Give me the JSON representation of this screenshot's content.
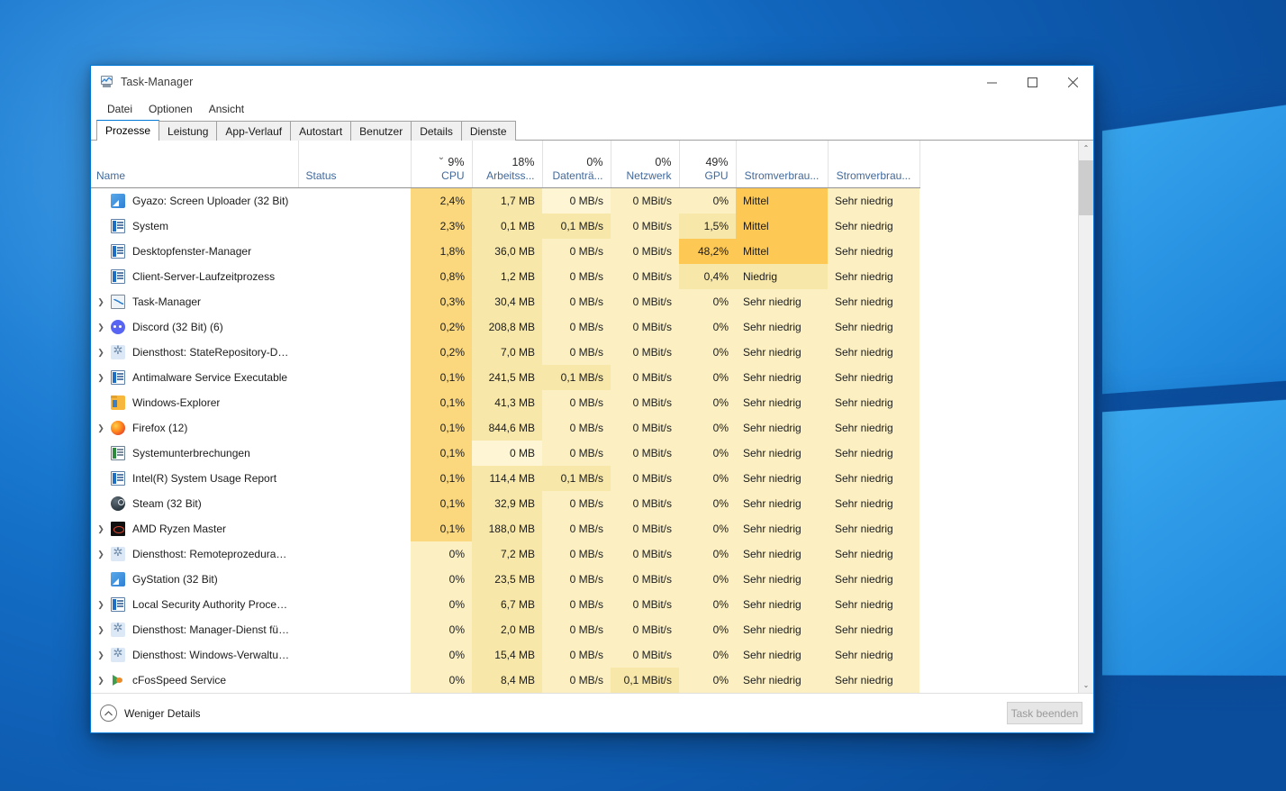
{
  "window": {
    "title": "Task-Manager",
    "title_icon": "task-manager-icon",
    "minimize_label": "−",
    "maximize_label": "□",
    "close_label": "✕"
  },
  "menu": {
    "items": [
      "Datei",
      "Optionen",
      "Ansicht"
    ]
  },
  "tabs": [
    {
      "label": "Prozesse",
      "active": true
    },
    {
      "label": "Leistung",
      "active": false
    },
    {
      "label": "App-Verlauf",
      "active": false
    },
    {
      "label": "Autostart",
      "active": false
    },
    {
      "label": "Benutzer",
      "active": false
    },
    {
      "label": "Details",
      "active": false
    },
    {
      "label": "Dienste",
      "active": false
    }
  ],
  "table": {
    "columns": [
      {
        "key": "name",
        "pct": "",
        "label": "Name",
        "align": "left",
        "sorted": false
      },
      {
        "key": "status",
        "pct": "",
        "label": "Status",
        "align": "left",
        "sorted": false
      },
      {
        "key": "cpu",
        "pct": "9%",
        "label": "CPU",
        "align": "right",
        "sorted": true
      },
      {
        "key": "memory",
        "pct": "18%",
        "label": "Arbeitss...",
        "align": "right",
        "sorted": false
      },
      {
        "key": "disk",
        "pct": "0%",
        "label": "Datenträ...",
        "align": "right",
        "sorted": false
      },
      {
        "key": "network",
        "pct": "0%",
        "label": "Netzwerk",
        "align": "right",
        "sorted": false
      },
      {
        "key": "gpu",
        "pct": "49%",
        "label": "GPU",
        "align": "right",
        "sorted": false
      },
      {
        "key": "power",
        "pct": "",
        "label": "Stromverbrau...",
        "align": "left",
        "sorted": false
      },
      {
        "key": "power2",
        "pct": "",
        "label": "Stromverbrau...",
        "align": "left",
        "sorted": false
      }
    ],
    "sort_indicator": "⌄",
    "rows": [
      {
        "expand": false,
        "icon": "gyazo-icon",
        "name": "Gyazo: Screen Uploader (32 Bit)",
        "status": "",
        "cpu": "2,4%",
        "memory": "1,7 MB",
        "disk": "0 MB/s",
        "network": "0 MBit/s",
        "gpu": "0%",
        "power": "Mittel",
        "power2": "Sehr niedrig",
        "heat": {
          "cpu": "h3",
          "memory": "h2",
          "disk": "h0",
          "network": "h1",
          "gpu": "h1",
          "power": "h4",
          "power2": "h1"
        }
      },
      {
        "expand": false,
        "icon": "windows-service-icon",
        "name": "System",
        "status": "",
        "cpu": "2,3%",
        "memory": "0,1 MB",
        "disk": "0,1 MB/s",
        "network": "0 MBit/s",
        "gpu": "1,5%",
        "power": "Mittel",
        "power2": "Sehr niedrig",
        "heat": {
          "cpu": "h3",
          "memory": "h2",
          "disk": "h2",
          "network": "h1",
          "gpu": "h2",
          "power": "h4",
          "power2": "h1"
        }
      },
      {
        "expand": false,
        "icon": "windows-service-icon",
        "name": "Desktopfenster-Manager",
        "status": "",
        "cpu": "1,8%",
        "memory": "36,0 MB",
        "disk": "0 MB/s",
        "network": "0 MBit/s",
        "gpu": "48,2%",
        "power": "Mittel",
        "power2": "Sehr niedrig",
        "heat": {
          "cpu": "h3",
          "memory": "h2",
          "disk": "h1",
          "network": "h1",
          "gpu": "h4",
          "power": "h4",
          "power2": "h1"
        }
      },
      {
        "expand": false,
        "icon": "windows-service-icon",
        "name": "Client-Server-Laufzeitprozess",
        "status": "",
        "cpu": "0,8%",
        "memory": "1,2 MB",
        "disk": "0 MB/s",
        "network": "0 MBit/s",
        "gpu": "0,4%",
        "power": "Niedrig",
        "power2": "Sehr niedrig",
        "heat": {
          "cpu": "h3",
          "memory": "h2",
          "disk": "h1",
          "network": "h1",
          "gpu": "h2",
          "power": "h2",
          "power2": "h1"
        }
      },
      {
        "expand": true,
        "icon": "task-manager-icon",
        "name": "Task-Manager",
        "status": "",
        "cpu": "0,3%",
        "memory": "30,4 MB",
        "disk": "0 MB/s",
        "network": "0 MBit/s",
        "gpu": "0%",
        "power": "Sehr niedrig",
        "power2": "Sehr niedrig",
        "heat": {
          "cpu": "h3",
          "memory": "h2",
          "disk": "h1",
          "network": "h1",
          "gpu": "h1",
          "power": "h1",
          "power2": "h1"
        }
      },
      {
        "expand": true,
        "icon": "discord-icon",
        "name": "Discord (32 Bit) (6)",
        "status": "",
        "cpu": "0,2%",
        "memory": "208,8 MB",
        "disk": "0 MB/s",
        "network": "0 MBit/s",
        "gpu": "0%",
        "power": "Sehr niedrig",
        "power2": "Sehr niedrig",
        "heat": {
          "cpu": "h3",
          "memory": "h2",
          "disk": "h1",
          "network": "h1",
          "gpu": "h1",
          "power": "h1",
          "power2": "h1"
        }
      },
      {
        "expand": true,
        "icon": "gear-icon",
        "name": "Diensthost: StateRepository-Die...",
        "status": "",
        "cpu": "0,2%",
        "memory": "7,0 MB",
        "disk": "0 MB/s",
        "network": "0 MBit/s",
        "gpu": "0%",
        "power": "Sehr niedrig",
        "power2": "Sehr niedrig",
        "heat": {
          "cpu": "h3",
          "memory": "h2",
          "disk": "h1",
          "network": "h1",
          "gpu": "h1",
          "power": "h1",
          "power2": "h1"
        }
      },
      {
        "expand": true,
        "icon": "windows-service-icon",
        "name": "Antimalware Service Executable",
        "status": "",
        "cpu": "0,1%",
        "memory": "241,5 MB",
        "disk": "0,1 MB/s",
        "network": "0 MBit/s",
        "gpu": "0%",
        "power": "Sehr niedrig",
        "power2": "Sehr niedrig",
        "heat": {
          "cpu": "h3",
          "memory": "h2",
          "disk": "h2",
          "network": "h1",
          "gpu": "h1",
          "power": "h1",
          "power2": "h1"
        }
      },
      {
        "expand": false,
        "icon": "folder-icon",
        "name": "Windows-Explorer",
        "status": "",
        "cpu": "0,1%",
        "memory": "41,3 MB",
        "disk": "0 MB/s",
        "network": "0 MBit/s",
        "gpu": "0%",
        "power": "Sehr niedrig",
        "power2": "Sehr niedrig",
        "heat": {
          "cpu": "h3",
          "memory": "h2",
          "disk": "h1",
          "network": "h1",
          "gpu": "h1",
          "power": "h1",
          "power2": "h1"
        }
      },
      {
        "expand": true,
        "icon": "firefox-icon",
        "name": "Firefox (12)",
        "status": "",
        "cpu": "0,1%",
        "memory": "844,6 MB",
        "disk": "0 MB/s",
        "network": "0 MBit/s",
        "gpu": "0%",
        "power": "Sehr niedrig",
        "power2": "Sehr niedrig",
        "heat": {
          "cpu": "h3",
          "memory": "h2",
          "disk": "h1",
          "network": "h1",
          "gpu": "h1",
          "power": "h1",
          "power2": "h1"
        }
      },
      {
        "expand": false,
        "icon": "windows-green-icon",
        "name": "Systemunterbrechungen",
        "status": "",
        "cpu": "0,1%",
        "memory": "0 MB",
        "disk": "0 MB/s",
        "network": "0 MBit/s",
        "gpu": "0%",
        "power": "Sehr niedrig",
        "power2": "Sehr niedrig",
        "heat": {
          "cpu": "h3",
          "memory": "h0",
          "disk": "h1",
          "network": "h1",
          "gpu": "h1",
          "power": "h1",
          "power2": "h1"
        }
      },
      {
        "expand": false,
        "icon": "windows-service-icon",
        "name": "Intel(R) System Usage Report",
        "status": "",
        "cpu": "0,1%",
        "memory": "114,4 MB",
        "disk": "0,1 MB/s",
        "network": "0 MBit/s",
        "gpu": "0%",
        "power": "Sehr niedrig",
        "power2": "Sehr niedrig",
        "heat": {
          "cpu": "h3",
          "memory": "h2",
          "disk": "h2",
          "network": "h1",
          "gpu": "h1",
          "power": "h1",
          "power2": "h1"
        }
      },
      {
        "expand": false,
        "icon": "steam-icon",
        "name": "Steam (32 Bit)",
        "status": "",
        "cpu": "0,1%",
        "memory": "32,9 MB",
        "disk": "0 MB/s",
        "network": "0 MBit/s",
        "gpu": "0%",
        "power": "Sehr niedrig",
        "power2": "Sehr niedrig",
        "heat": {
          "cpu": "h3",
          "memory": "h2",
          "disk": "h1",
          "network": "h1",
          "gpu": "h1",
          "power": "h1",
          "power2": "h1"
        }
      },
      {
        "expand": true,
        "icon": "amd-icon",
        "name": "AMD Ryzen Master",
        "status": "",
        "cpu": "0,1%",
        "memory": "188,0 MB",
        "disk": "0 MB/s",
        "network": "0 MBit/s",
        "gpu": "0%",
        "power": "Sehr niedrig",
        "power2": "Sehr niedrig",
        "heat": {
          "cpu": "h3",
          "memory": "h2",
          "disk": "h1",
          "network": "h1",
          "gpu": "h1",
          "power": "h1",
          "power2": "h1"
        }
      },
      {
        "expand": true,
        "icon": "gear-icon",
        "name": "Diensthost: Remoteprozedurauf...",
        "status": "",
        "cpu": "0%",
        "memory": "7,2 MB",
        "disk": "0 MB/s",
        "network": "0 MBit/s",
        "gpu": "0%",
        "power": "Sehr niedrig",
        "power2": "Sehr niedrig",
        "heat": {
          "cpu": "h1",
          "memory": "h2",
          "disk": "h1",
          "network": "h1",
          "gpu": "h1",
          "power": "h1",
          "power2": "h1"
        }
      },
      {
        "expand": false,
        "icon": "gyazo-icon",
        "name": "GyStation (32 Bit)",
        "status": "",
        "cpu": "0%",
        "memory": "23,5 MB",
        "disk": "0 MB/s",
        "network": "0 MBit/s",
        "gpu": "0%",
        "power": "Sehr niedrig",
        "power2": "Sehr niedrig",
        "heat": {
          "cpu": "h1",
          "memory": "h2",
          "disk": "h1",
          "network": "h1",
          "gpu": "h1",
          "power": "h1",
          "power2": "h1"
        }
      },
      {
        "expand": true,
        "icon": "windows-service-icon",
        "name": "Local Security Authority Process...",
        "status": "",
        "cpu": "0%",
        "memory": "6,7 MB",
        "disk": "0 MB/s",
        "network": "0 MBit/s",
        "gpu": "0%",
        "power": "Sehr niedrig",
        "power2": "Sehr niedrig",
        "heat": {
          "cpu": "h1",
          "memory": "h2",
          "disk": "h1",
          "network": "h1",
          "gpu": "h1",
          "power": "h1",
          "power2": "h1"
        }
      },
      {
        "expand": true,
        "icon": "gear-icon",
        "name": "Diensthost: Manager-Dienst für ...",
        "status": "",
        "cpu": "0%",
        "memory": "2,0 MB",
        "disk": "0 MB/s",
        "network": "0 MBit/s",
        "gpu": "0%",
        "power": "Sehr niedrig",
        "power2": "Sehr niedrig",
        "heat": {
          "cpu": "h1",
          "memory": "h2",
          "disk": "h1",
          "network": "h1",
          "gpu": "h1",
          "power": "h1",
          "power2": "h1"
        }
      },
      {
        "expand": true,
        "icon": "gear-icon",
        "name": "Diensthost: Windows-Verwaltun...",
        "status": "",
        "cpu": "0%",
        "memory": "15,4 MB",
        "disk": "0 MB/s",
        "network": "0 MBit/s",
        "gpu": "0%",
        "power": "Sehr niedrig",
        "power2": "Sehr niedrig",
        "heat": {
          "cpu": "h1",
          "memory": "h2",
          "disk": "h1",
          "network": "h1",
          "gpu": "h1",
          "power": "h1",
          "power2": "h1"
        }
      },
      {
        "expand": true,
        "icon": "cfosspeed-icon",
        "name": "cFosSpeed Service",
        "status": "",
        "cpu": "0%",
        "memory": "8,4 MB",
        "disk": "0 MB/s",
        "network": "0,1 MBit/s",
        "gpu": "0%",
        "power": "Sehr niedrig",
        "power2": "Sehr niedrig",
        "heat": {
          "cpu": "h1",
          "memory": "h2",
          "disk": "h1",
          "network": "h2",
          "gpu": "h1",
          "power": "h1",
          "power2": "h1"
        }
      }
    ]
  },
  "scrollbar": {
    "up_arrow": "⌃",
    "down_arrow": "⌄"
  },
  "statusbar": {
    "less_details_label": "Weniger Details",
    "less_details_icon": "chevron-up-circle-icon",
    "end_task_label": "Task beenden"
  },
  "colors": {
    "accent": "#0078d7",
    "header_text": "#41699c",
    "heat_lightest": "#fdf5d3",
    "heat_light": "#fcf0c3",
    "heat_mid": "#f7e7a9",
    "heat_warm": "#fbd77d",
    "heat_hot": "#fdc854"
  }
}
